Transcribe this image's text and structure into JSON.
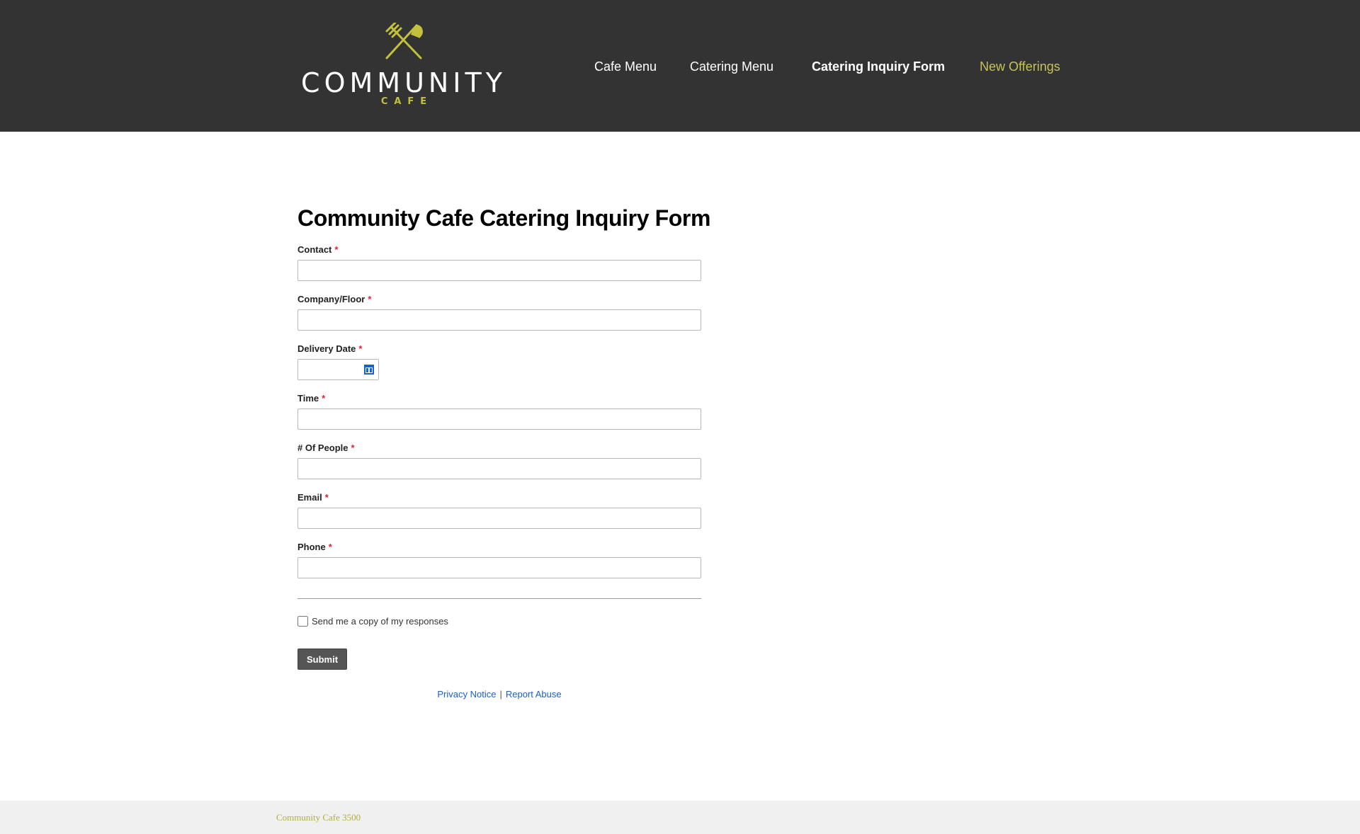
{
  "brand": {
    "name": "COMMUNITY",
    "tagline": "CAFE",
    "colors": {
      "header_bg": "#333333",
      "accent": "#c3c13c",
      "required": "#d7263d",
      "link": "#1a5fcc"
    }
  },
  "nav": {
    "items": [
      {
        "label": "Cafe Menu",
        "state": "normal"
      },
      {
        "label": "Catering Menu",
        "state": "normal"
      },
      {
        "label": "Catering Inquiry Form",
        "state": "active"
      },
      {
        "label": "New Offerings",
        "state": "accent"
      }
    ]
  },
  "form": {
    "title": "Community Cafe Catering Inquiry Form",
    "required_marker": "*",
    "fields": [
      {
        "label": "Contact",
        "value": ""
      },
      {
        "label": "Company/Floor",
        "value": ""
      },
      {
        "label": "Delivery Date",
        "value": "",
        "icon": "calendar-icon"
      },
      {
        "label": "Time",
        "value": ""
      },
      {
        "label": "# Of People",
        "value": ""
      },
      {
        "label": "Email",
        "value": ""
      },
      {
        "label": "Phone",
        "value": ""
      }
    ],
    "copy_checkbox": {
      "label": "Send me a copy of my responses",
      "checked": false
    },
    "submit_label": "Submit",
    "links": {
      "privacy": "Privacy Notice",
      "separator": "|",
      "abuse": "Report Abuse"
    }
  },
  "footer": {
    "text": "Community Cafe 3500"
  }
}
